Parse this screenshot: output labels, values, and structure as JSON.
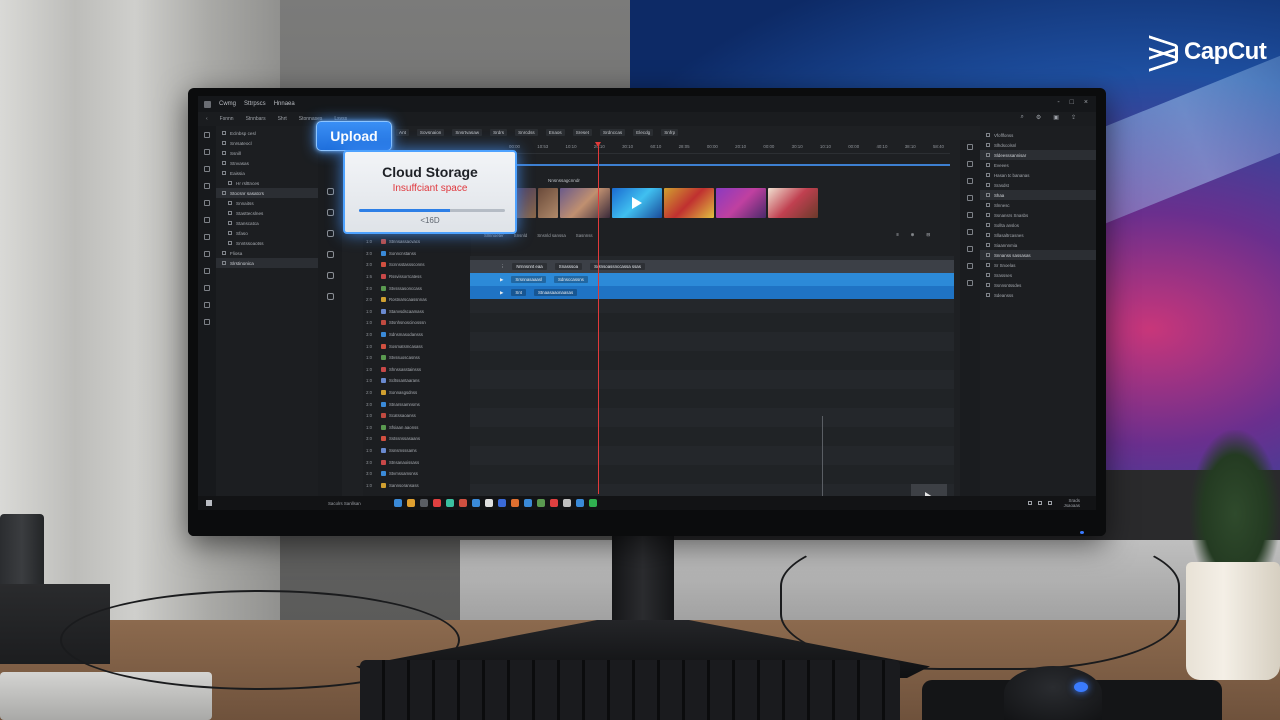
{
  "watermark": {
    "brand": "CapCut"
  },
  "app": {
    "title_items": [
      "Cwmg",
      "Sttrpscs",
      "Hnnaea"
    ],
    "menu_items": [
      "Fsnnn",
      "Stnnbars",
      "Shrt",
      "Stonnases",
      "Lsvss"
    ],
    "win_ctrls": [
      "-",
      "□",
      "×"
    ]
  },
  "left_panel": {
    "items": [
      {
        "label": "Eclnbsp cesl",
        "sel": false,
        "indent": false
      },
      {
        "label": "Snrsateocl",
        "sel": false,
        "indent": false
      },
      {
        "label": "Ssnill",
        "sel": false,
        "indent": false
      },
      {
        "label": "Stnvasas",
        "sel": false,
        "indent": false
      },
      {
        "label": "Eaissia",
        "sel": false,
        "indent": false
      },
      {
        "label": "Hr rslttnces",
        "sel": false,
        "indent": true
      },
      {
        "label": "Stocsnr sasatcrs",
        "sel": true,
        "indent": false
      },
      {
        "label": "Snnaitss",
        "sel": false,
        "indent": true
      },
      {
        "label": "Stasttecslnes",
        "sel": false,
        "indent": true
      },
      {
        "label": "Stanscatca",
        "sel": false,
        "indent": true
      },
      {
        "label": "Sfaso",
        "sel": false,
        "indent": true
      },
      {
        "label": "Snntssoaotss",
        "sel": false,
        "indent": true
      },
      {
        "label": "Fliosa",
        "sel": false,
        "indent": false
      },
      {
        "label": "Slrstinonica",
        "sel": true,
        "indent": false
      }
    ]
  },
  "topbar": {
    "chips": [
      "Ant",
      "Sovsnaion",
      "Snsrtvasaw",
      "Srdrs",
      "Snrcdss",
      "Enaos",
      "Sreset",
      "Srdnccas",
      "Elecdg",
      "Snfrp"
    ]
  },
  "ruler": {
    "labels": [
      "00:00",
      "10:53",
      "10:10",
      "20:10",
      "30:10",
      "60:10",
      "28:05",
      "00:00",
      "20:10",
      "00:00",
      "30:10",
      "10:10",
      "00:00",
      "40:10",
      "38:10",
      "58:40"
    ]
  },
  "thumbs": {
    "label": "Nnsnssagcnndr",
    "colors": [
      "t0",
      "t1",
      "t2",
      "t3",
      "t4",
      "t5",
      "t6"
    ]
  },
  "list": {
    "rows": [
      {
        "num": "1:0",
        "label": "Stnnsassacvacs",
        "color": "#c04a40"
      },
      {
        "num": "3:0",
        "label": "Sonncnstanss",
        "color": "#3a8ad8"
      },
      {
        "num": "3:0",
        "label": "Scnnsstasssconns",
        "color": "#d05040"
      },
      {
        "num": "1:6",
        "label": "Rssvissorrcatess",
        "color": "#c84848"
      },
      {
        "num": "3:0",
        "label": "Stvsssasonccass",
        "color": "#5a9a50"
      },
      {
        "num": "2:0",
        "label": "Rostnarscaassnnas",
        "color": "#d0a030"
      },
      {
        "num": "1:0",
        "label": "Stanvsdscaamass",
        "color": "#6a8ad0"
      },
      {
        "num": "1:0",
        "label": "Stsnhsnoscinosssn",
        "color": "#c04a40"
      },
      {
        "num": "3:0",
        "label": "Sdnsmasodansss",
        "color": "#3a8ad8"
      },
      {
        "num": "1:0",
        "label": "Sosmatsmcasass",
        "color": "#d05040"
      },
      {
        "num": "1:0",
        "label": "Stvssuoscasnss",
        "color": "#5a9a50"
      },
      {
        "num": "1:0",
        "label": "Shnssasstainsss",
        "color": "#c84848"
      },
      {
        "num": "1:0",
        "label": "Scltssantaarans",
        "color": "#6a8ad0"
      },
      {
        "num": "2:0",
        "label": "Sonnasgsdnss",
        "color": "#d0a030"
      },
      {
        "num": "3:0",
        "label": "Stnarssamnsms",
        "color": "#3a8ad8"
      },
      {
        "num": "1:0",
        "label": "Scatssaoanss",
        "color": "#c04a40"
      },
      {
        "num": "1:0",
        "label": "Sfsiaan aaonss",
        "color": "#5a9a50"
      },
      {
        "num": "3:0",
        "label": "Sstssnssasaans",
        "color": "#d05040"
      },
      {
        "num": "1:0",
        "label": "Ssnsmsssams",
        "color": "#6a8ad0"
      },
      {
        "num": "3:0",
        "label": "Stnsanaoissass",
        "color": "#c84848"
      },
      {
        "num": "3:0",
        "label": "Stvmssamsnss",
        "color": "#3a8ad8"
      },
      {
        "num": "1:0",
        "label": "Sannsoransass",
        "color": "#d0a030"
      }
    ]
  },
  "timeline": {
    "header": [
      "Sllnnoeter",
      "Snsnld",
      "Snsnld sanssa",
      "Sasnnss"
    ],
    "ctrls": [
      "≡",
      "⊕",
      "⊟"
    ],
    "tracks": [
      {
        "icon": "⋮",
        "pills": [
          "Nrnnsnnt eaa",
          "Snasssoa",
          "Sotnsoassnccassa ssas"
        ]
      },
      {
        "icon": "▶",
        "pills": [
          "Srsnnasaaasl",
          "Sdnsccassns"
        ]
      },
      {
        "icon": "▶",
        "pills": [
          "Snt",
          "Stnaasaaonaasas"
        ]
      }
    ]
  },
  "right_panel": {
    "items": [
      {
        "label": "Vfoflfonss",
        "sel": false
      },
      {
        "label": "Slhdscolsnl",
        "sel": false
      },
      {
        "label": "Sldeesssannisar",
        "sel": true
      },
      {
        "label": "Eveees",
        "sel": false
      },
      {
        "label": "Hasan tc bananas",
        "sel": false
      },
      {
        "label": "Srasdst",
        "sel": false
      },
      {
        "label": "Shaa",
        "sel": true
      },
      {
        "label": "Slnnesc",
        "sel": false
      },
      {
        "label": "Ssnansrs Snasbs",
        "sel": false
      },
      {
        "label": "Sollta anslos",
        "sel": false
      },
      {
        "label": "Sllasaltrcasnes",
        "sel": false
      },
      {
        "label": "Siaannnmia",
        "sel": false
      },
      {
        "label": "Snnanss sassasas",
        "sel": true
      },
      {
        "label": "Sr Snoelas",
        "sel": false
      },
      {
        "label": "Srassses",
        "sel": false
      },
      {
        "label": "Ssnnsntssdes",
        "sel": false
      },
      {
        "label": "Sdeansss",
        "sel": false
      }
    ]
  },
  "statusbar": {
    "left_text": "Sacolrs Sanllsan",
    "clock_time": "Srads",
    "clock_date": "Jsaoaas",
    "task_colors": [
      "#3a8ad8",
      "#e0a030",
      "#5a5e64",
      "#e04040",
      "#3ac0a0",
      "#d05040",
      "#3a8ad8",
      "#e0e0e0",
      "#3a6ad8",
      "#e07030",
      "#3a8ad8",
      "#5a9a50",
      "#e04040",
      "#c0c0c0",
      "#3a8ad8",
      "#30b050"
    ]
  },
  "upload": {
    "label": "Upload"
  },
  "storage": {
    "title": "Cloud Storage",
    "warning": "Insuffciant space",
    "progress": 0.62,
    "capacity": "<16D",
    "accent": "#2d7fe6",
    "warning_color": "#e0393e"
  }
}
